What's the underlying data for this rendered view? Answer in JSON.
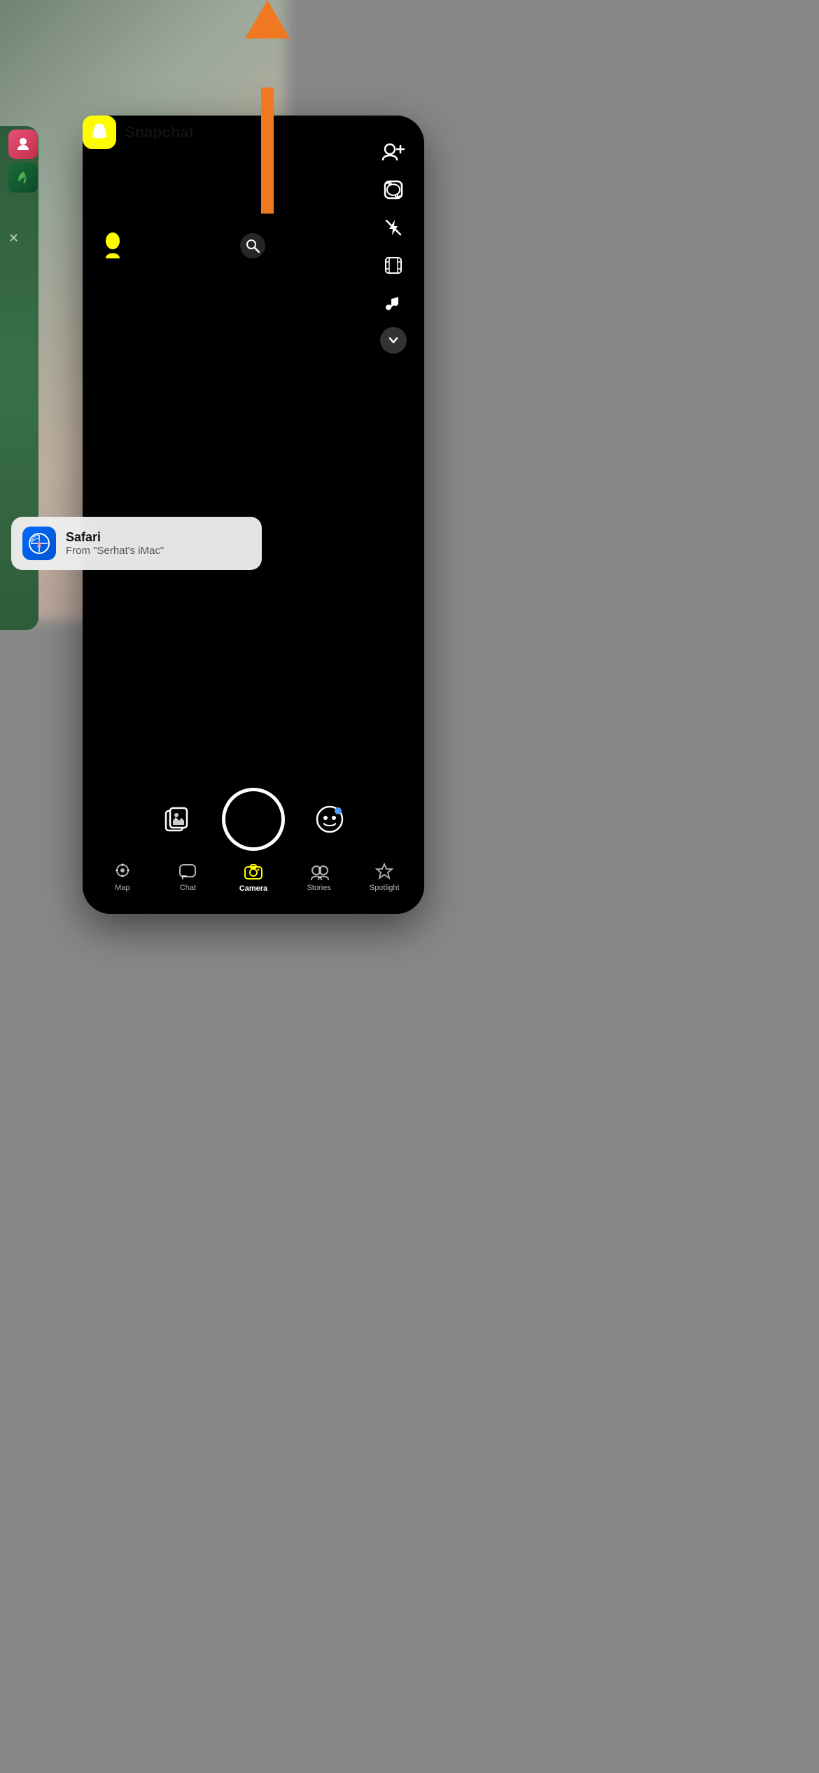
{
  "background": {
    "color": "#888888"
  },
  "arrow": {
    "color": "#F07820"
  },
  "snapchat_header": {
    "app_name": "Snapchat",
    "logo_emoji": "👻"
  },
  "snapchat_nav": {
    "items": [
      {
        "id": "map",
        "label": "Map",
        "active": false
      },
      {
        "id": "chat",
        "label": "Chat",
        "active": false
      },
      {
        "id": "camera",
        "label": "Camera",
        "active": true
      },
      {
        "id": "stories",
        "label": "Stories",
        "active": false
      },
      {
        "id": "spotlight",
        "label": "Spotlight",
        "active": false
      }
    ]
  },
  "safari_notification": {
    "title": "Safari",
    "subtitle": "From \"Serhat's iMac\""
  },
  "left_apps": {
    "close_symbol": "✕"
  }
}
